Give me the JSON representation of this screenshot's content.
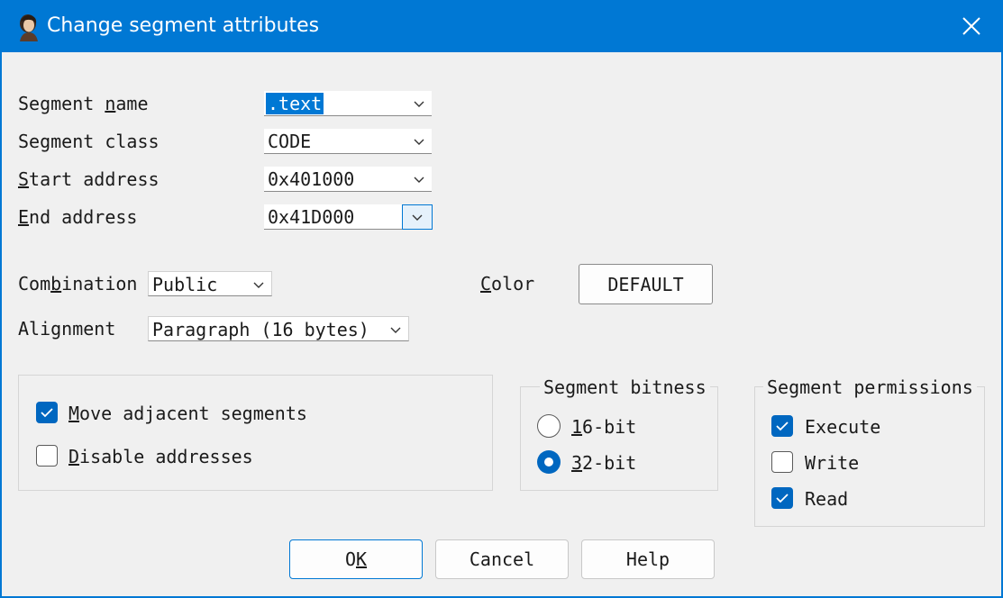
{
  "window": {
    "title": "Change segment attributes"
  },
  "fields": {
    "segment_name": {
      "label_pre": "Segment ",
      "label_key": "n",
      "label_post": "ame",
      "value": ".text"
    },
    "segment_class": {
      "label": "Segment class",
      "value": "CODE"
    },
    "start_address": {
      "label_key": "S",
      "label_post": "tart address",
      "value": "0x401000"
    },
    "end_address": {
      "label_key": "E",
      "label_post": "nd address",
      "value": "0x41D000"
    },
    "combination": {
      "label_pre": "Com",
      "label_key": "b",
      "label_post": "ination",
      "value": "Public"
    },
    "color": {
      "label_key": "C",
      "label_post": "olor",
      "button": "DEFAULT"
    },
    "alignment": {
      "label": "Alignment",
      "value": "Paragraph (16 bytes)"
    }
  },
  "options": {
    "move_adjacent": {
      "label_key": "M",
      "label_post": "ove adjacent segments",
      "checked": true
    },
    "disable_addresses": {
      "label_key": "D",
      "label_post": "isable addresses",
      "checked": false
    }
  },
  "bitness": {
    "title": "Segment bitness",
    "options": [
      {
        "label_key": "1",
        "label_post": "6-bit",
        "selected": false
      },
      {
        "label_key": "3",
        "label_post": "2-bit",
        "selected": true
      }
    ]
  },
  "permissions": {
    "title": "Segment permissions",
    "items": [
      {
        "label": "Execute",
        "checked": true
      },
      {
        "label": "Write",
        "checked": false
      },
      {
        "label": "Read",
        "checked": true
      }
    ]
  },
  "buttons": {
    "ok": {
      "label_pre": "O",
      "label_key": "K"
    },
    "cancel": "Cancel",
    "help": "Help"
  },
  "colors": {
    "accent": "#0078d4",
    "checked": "#0067c0",
    "dialog_bg": "#f0f0f0"
  },
  "icons": {
    "app": "portrait-icon",
    "close": "close-icon",
    "dropdown": "chevron-down-icon",
    "check": "checkmark-icon"
  }
}
